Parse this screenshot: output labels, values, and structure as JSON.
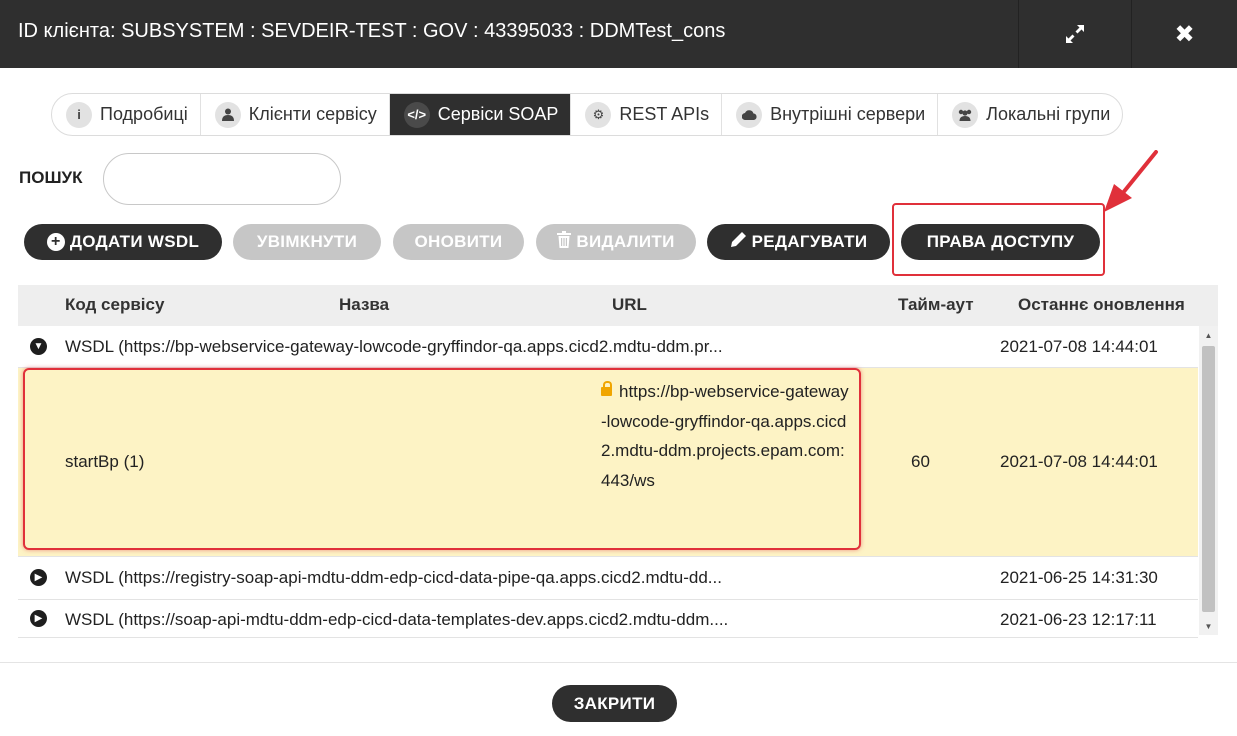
{
  "dialog": {
    "title": "ID клієнта: SUBSYSTEM : SEVDEIR-TEST : GOV : 43395033 : DDMTest_cons",
    "expand_icon": "expand-arrows-icon",
    "close_icon": "close-x-icon"
  },
  "tabs": [
    {
      "label": "Подробиці",
      "icon": "info-icon"
    },
    {
      "label": "Клієнти сервісу",
      "icon": "user-icon"
    },
    {
      "label": "Сервіси SOAP",
      "icon": "code-icon",
      "active": true
    },
    {
      "label": "REST APIs",
      "icon": "cogs-icon"
    },
    {
      "label": "Внутрішні сервери",
      "icon": "cloud-icon"
    },
    {
      "label": "Локальні групи",
      "icon": "users-icon"
    }
  ],
  "search": {
    "label": "ПОШУК",
    "value": "",
    "placeholder": ""
  },
  "toolbar": {
    "add_wsdl": "ДОДАТИ WSDL",
    "enable": "УВІМКНУТИ",
    "refresh": "ОНОВИТИ",
    "delete": "ВИДАЛИТИ",
    "edit": "РЕДАГУВАТИ",
    "access_rights": "ПРАВА ДОСТУПУ"
  },
  "table": {
    "columns": [
      "Код сервісу",
      "Назва",
      "URL",
      "Тайм-аут",
      "Останнє оновлення"
    ],
    "rows": [
      {
        "type": "wsdl",
        "expanded": true,
        "text": "WSDL (https://bp-webservice-gateway-lowcode-gryffindor-qa.apps.cicd2.mdtu-ddm.pr...",
        "updated": "2021-07-08 14:44:01"
      },
      {
        "type": "service",
        "selected": true,
        "code": "startBp (1)",
        "name": "",
        "url": "https://bp-webservice-gateway-lowcode-gryffindor-qa.apps.cicd2.mdtu-ddm.projects.epam.com:443/ws",
        "timeout": "60",
        "updated": "2021-07-08 14:44:01"
      },
      {
        "type": "wsdl",
        "expanded": false,
        "text": "WSDL (https://registry-soap-api-mdtu-ddm-edp-cicd-data-pipe-qa.apps.cicd2.mdtu-dd...",
        "updated": "2021-06-25 14:31:30"
      },
      {
        "type": "wsdl",
        "expanded": false,
        "text": "WSDL (https://soap-api-mdtu-ddm-edp-cicd-data-templates-dev.apps.cicd2.mdtu-ddm....",
        "updated": "2021-06-23 12:17:11"
      }
    ]
  },
  "footer": {
    "close": "ЗАКРИТИ"
  },
  "colors": {
    "dark": "#2f2f2f",
    "disabled": "#c6c6c6",
    "highlight": "#e0303a",
    "selected_row": "#fdf3c5"
  }
}
